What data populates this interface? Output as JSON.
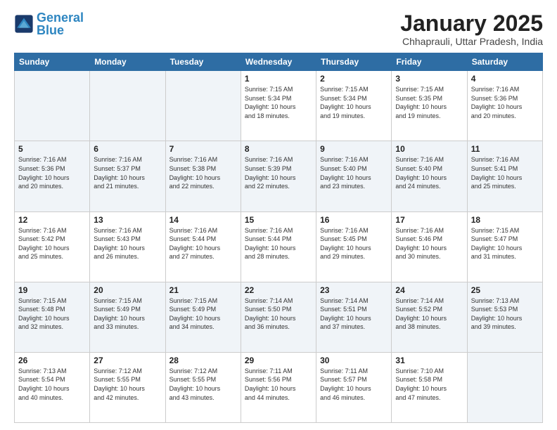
{
  "logo": {
    "text1": "General",
    "text2": "Blue"
  },
  "title": "January 2025",
  "subtitle": "Chhaprauli, Uttar Pradesh, India",
  "weekdays": [
    "Sunday",
    "Monday",
    "Tuesday",
    "Wednesday",
    "Thursday",
    "Friday",
    "Saturday"
  ],
  "weeks": [
    [
      {
        "day": "",
        "info": ""
      },
      {
        "day": "",
        "info": ""
      },
      {
        "day": "",
        "info": ""
      },
      {
        "day": "1",
        "info": "Sunrise: 7:15 AM\nSunset: 5:34 PM\nDaylight: 10 hours\nand 18 minutes."
      },
      {
        "day": "2",
        "info": "Sunrise: 7:15 AM\nSunset: 5:34 PM\nDaylight: 10 hours\nand 19 minutes."
      },
      {
        "day": "3",
        "info": "Sunrise: 7:15 AM\nSunset: 5:35 PM\nDaylight: 10 hours\nand 19 minutes."
      },
      {
        "day": "4",
        "info": "Sunrise: 7:16 AM\nSunset: 5:36 PM\nDaylight: 10 hours\nand 20 minutes."
      }
    ],
    [
      {
        "day": "5",
        "info": "Sunrise: 7:16 AM\nSunset: 5:36 PM\nDaylight: 10 hours\nand 20 minutes."
      },
      {
        "day": "6",
        "info": "Sunrise: 7:16 AM\nSunset: 5:37 PM\nDaylight: 10 hours\nand 21 minutes."
      },
      {
        "day": "7",
        "info": "Sunrise: 7:16 AM\nSunset: 5:38 PM\nDaylight: 10 hours\nand 22 minutes."
      },
      {
        "day": "8",
        "info": "Sunrise: 7:16 AM\nSunset: 5:39 PM\nDaylight: 10 hours\nand 22 minutes."
      },
      {
        "day": "9",
        "info": "Sunrise: 7:16 AM\nSunset: 5:40 PM\nDaylight: 10 hours\nand 23 minutes."
      },
      {
        "day": "10",
        "info": "Sunrise: 7:16 AM\nSunset: 5:40 PM\nDaylight: 10 hours\nand 24 minutes."
      },
      {
        "day": "11",
        "info": "Sunrise: 7:16 AM\nSunset: 5:41 PM\nDaylight: 10 hours\nand 25 minutes."
      }
    ],
    [
      {
        "day": "12",
        "info": "Sunrise: 7:16 AM\nSunset: 5:42 PM\nDaylight: 10 hours\nand 25 minutes."
      },
      {
        "day": "13",
        "info": "Sunrise: 7:16 AM\nSunset: 5:43 PM\nDaylight: 10 hours\nand 26 minutes."
      },
      {
        "day": "14",
        "info": "Sunrise: 7:16 AM\nSunset: 5:44 PM\nDaylight: 10 hours\nand 27 minutes."
      },
      {
        "day": "15",
        "info": "Sunrise: 7:16 AM\nSunset: 5:44 PM\nDaylight: 10 hours\nand 28 minutes."
      },
      {
        "day": "16",
        "info": "Sunrise: 7:16 AM\nSunset: 5:45 PM\nDaylight: 10 hours\nand 29 minutes."
      },
      {
        "day": "17",
        "info": "Sunrise: 7:16 AM\nSunset: 5:46 PM\nDaylight: 10 hours\nand 30 minutes."
      },
      {
        "day": "18",
        "info": "Sunrise: 7:15 AM\nSunset: 5:47 PM\nDaylight: 10 hours\nand 31 minutes."
      }
    ],
    [
      {
        "day": "19",
        "info": "Sunrise: 7:15 AM\nSunset: 5:48 PM\nDaylight: 10 hours\nand 32 minutes."
      },
      {
        "day": "20",
        "info": "Sunrise: 7:15 AM\nSunset: 5:49 PM\nDaylight: 10 hours\nand 33 minutes."
      },
      {
        "day": "21",
        "info": "Sunrise: 7:15 AM\nSunset: 5:49 PM\nDaylight: 10 hours\nand 34 minutes."
      },
      {
        "day": "22",
        "info": "Sunrise: 7:14 AM\nSunset: 5:50 PM\nDaylight: 10 hours\nand 36 minutes."
      },
      {
        "day": "23",
        "info": "Sunrise: 7:14 AM\nSunset: 5:51 PM\nDaylight: 10 hours\nand 37 minutes."
      },
      {
        "day": "24",
        "info": "Sunrise: 7:14 AM\nSunset: 5:52 PM\nDaylight: 10 hours\nand 38 minutes."
      },
      {
        "day": "25",
        "info": "Sunrise: 7:13 AM\nSunset: 5:53 PM\nDaylight: 10 hours\nand 39 minutes."
      }
    ],
    [
      {
        "day": "26",
        "info": "Sunrise: 7:13 AM\nSunset: 5:54 PM\nDaylight: 10 hours\nand 40 minutes."
      },
      {
        "day": "27",
        "info": "Sunrise: 7:12 AM\nSunset: 5:55 PM\nDaylight: 10 hours\nand 42 minutes."
      },
      {
        "day": "28",
        "info": "Sunrise: 7:12 AM\nSunset: 5:55 PM\nDaylight: 10 hours\nand 43 minutes."
      },
      {
        "day": "29",
        "info": "Sunrise: 7:11 AM\nSunset: 5:56 PM\nDaylight: 10 hours\nand 44 minutes."
      },
      {
        "day": "30",
        "info": "Sunrise: 7:11 AM\nSunset: 5:57 PM\nDaylight: 10 hours\nand 46 minutes."
      },
      {
        "day": "31",
        "info": "Sunrise: 7:10 AM\nSunset: 5:58 PM\nDaylight: 10 hours\nand 47 minutes."
      },
      {
        "day": "",
        "info": ""
      }
    ]
  ]
}
